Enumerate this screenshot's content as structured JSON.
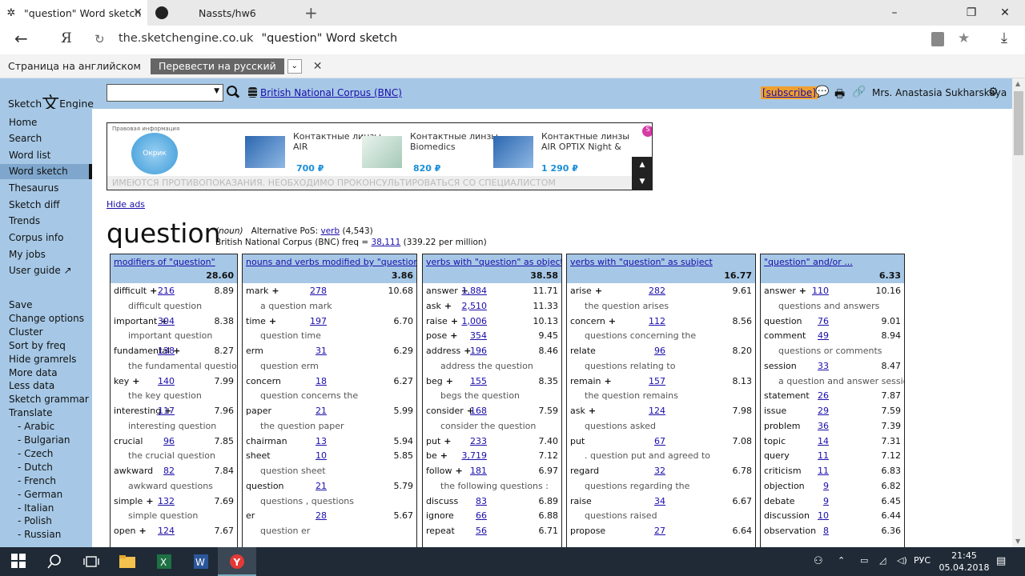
{
  "browser": {
    "tabs": [
      {
        "title": "\"question\" Word sketch",
        "close": "✕"
      },
      {
        "title": "Nassts/hw6"
      }
    ],
    "new_tab": "+",
    "window_controls": {
      "minimize": "–",
      "maximize": "❐",
      "close": "✕"
    },
    "back": "←",
    "yandex_logo": "Я",
    "reload": "↻",
    "url_domain": "the.sketchengine.co.uk",
    "url_title": "\"question\" Word sketch",
    "star": "★",
    "download": "⤓",
    "translate": {
      "label": "Страница на английском",
      "button": "Перевести на русский",
      "dropdown": "⌄",
      "close": "✕"
    }
  },
  "header": {
    "logo_left": "Sketch",
    "logo_mark": "文",
    "logo_right": "Engine",
    "search_value": "",
    "search_caret": "▼",
    "corpus": "British National Corpus (BNC)",
    "subscribe": "[subscribe]",
    "chat_icon": "💬",
    "print_icon": "🖶",
    "link_icon": "🔗",
    "user": "Mrs. Anastasia Sukharskaya",
    "gear_icon": "⚙"
  },
  "sidebar": {
    "nav": [
      "Home",
      "Search",
      "Word list",
      "Word sketch",
      "Thesaurus",
      "Sketch diff",
      "Trends",
      "Corpus info",
      "My jobs",
      "User guide ↗"
    ],
    "selected": "Word sketch",
    "actions": [
      "Save",
      "Change options",
      "Cluster",
      "Sort by freq",
      "Hide gramrels",
      "More data",
      "Less data",
      "Sketch grammar",
      "Translate"
    ],
    "languages": [
      "- Arabic",
      "- Bulgarian",
      "- Czech",
      "- Dutch",
      "- French",
      "- German",
      "- Italian",
      "- Polish",
      "- Russian"
    ]
  },
  "ad": {
    "legal": "Правовая информация",
    "logo_text": "Окрик",
    "products": [
      {
        "name": "Контактные линзы AIR",
        "price": "700 ₽"
      },
      {
        "name": "Контактные линзы Biomedics",
        "price": "820 ₽"
      },
      {
        "name": "Контактные линзы AIR OPTIX Night &",
        "price": "1 290 ₽"
      }
    ],
    "warning": "ИМЕЮТСЯ ПРОТИВОПОКАЗАНИЯ. НЕОБХОДИМО ПРОКОНСУЛЬТИРОВАТЬСЯ СО СПЕЦИАЛИСТОМ",
    "up": "▲",
    "down": "▼",
    "badge": "S"
  },
  "hide_ads": "Hide ads",
  "headword": {
    "word": "question",
    "pos": "(noun)",
    "alt_label": "Alternative PoS:",
    "alt_pos": "verb",
    "alt_count": "(4,543)",
    "freq_label": "British National Corpus (BNC) freq =",
    "freq": "38,111",
    "per_million": "(339.22 per million)"
  },
  "gramrels": [
    {
      "title": "modifiers of \"question\"",
      "score": "28.60",
      "rows": [
        {
          "word": "difficult",
          "plus": true,
          "freq": "216",
          "score": "8.89"
        },
        {
          "example": "difficult question"
        },
        {
          "word": "important",
          "plus": true,
          "freq": "304",
          "score": "8.38"
        },
        {
          "example": "important question"
        },
        {
          "word": "fundamental",
          "plus": true,
          "freq": "138",
          "score": "8.27"
        },
        {
          "example": "the fundamental question"
        },
        {
          "word": "key",
          "plus": true,
          "freq": "140",
          "score": "7.99"
        },
        {
          "example": "the key question"
        },
        {
          "word": "interesting",
          "plus": true,
          "freq": "117",
          "score": "7.96"
        },
        {
          "example": "interesting question"
        },
        {
          "word": "crucial",
          "plus": false,
          "freq": "96",
          "score": "7.85"
        },
        {
          "example": "the crucial question"
        },
        {
          "word": "awkward",
          "plus": false,
          "freq": "82",
          "score": "7.84"
        },
        {
          "example": "awkward questions"
        },
        {
          "word": "simple",
          "plus": true,
          "freq": "132",
          "score": "7.69"
        },
        {
          "example": "simple question"
        },
        {
          "word": "open",
          "plus": true,
          "freq": "124",
          "score": "7.67"
        }
      ]
    },
    {
      "title": "nouns and verbs modified by \"question\"",
      "score": "3.86",
      "rows": [
        {
          "word": "mark",
          "plus": true,
          "freq": "278",
          "score": "10.68"
        },
        {
          "example": "a question mark"
        },
        {
          "word": "time",
          "plus": true,
          "freq": "197",
          "score": "6.70"
        },
        {
          "example": "question time"
        },
        {
          "word": "erm",
          "plus": false,
          "freq": "31",
          "score": "6.29"
        },
        {
          "example": "question erm"
        },
        {
          "word": "concern",
          "plus": false,
          "freq": "18",
          "score": "6.27"
        },
        {
          "example": "question concerns the"
        },
        {
          "word": "paper",
          "plus": false,
          "freq": "21",
          "score": "5.99"
        },
        {
          "example": "the question paper"
        },
        {
          "word": "chairman",
          "plus": false,
          "freq": "13",
          "score": "5.94"
        },
        {
          "word": "sheet",
          "plus": false,
          "freq": "10",
          "score": "5.85"
        },
        {
          "example": "question sheet"
        },
        {
          "word": "question",
          "plus": false,
          "freq": "21",
          "score": "5.79"
        },
        {
          "example": "questions , questions"
        },
        {
          "word": "er",
          "plus": false,
          "freq": "28",
          "score": "5.67"
        },
        {
          "example": "question er"
        }
      ]
    },
    {
      "title": "verbs with \"question\" as object",
      "score": "38.58",
      "rows": [
        {
          "word": "answer",
          "plus": true,
          "freq": "1,884",
          "score": "11.71"
        },
        {
          "word": "ask",
          "plus": true,
          "freq": "2,510",
          "score": "11.33"
        },
        {
          "word": "raise",
          "plus": true,
          "freq": "1,006",
          "score": "10.13"
        },
        {
          "word": "pose",
          "plus": true,
          "freq": "354",
          "score": "9.45"
        },
        {
          "word": "address",
          "plus": true,
          "freq": "196",
          "score": "8.46"
        },
        {
          "example": "address the question"
        },
        {
          "word": "beg",
          "plus": true,
          "freq": "155",
          "score": "8.35"
        },
        {
          "example": "begs the question"
        },
        {
          "word": "consider",
          "plus": true,
          "freq": "168",
          "score": "7.59"
        },
        {
          "example": "consider the question"
        },
        {
          "word": "put",
          "plus": true,
          "freq": "233",
          "score": "7.40"
        },
        {
          "word": "be",
          "plus": true,
          "freq": "3,719",
          "score": "7.12"
        },
        {
          "word": "follow",
          "plus": true,
          "freq": "181",
          "score": "6.97"
        },
        {
          "example": "the following questions :"
        },
        {
          "word": "discuss",
          "plus": false,
          "freq": "83",
          "score": "6.89"
        },
        {
          "word": "ignore",
          "plus": false,
          "freq": "66",
          "score": "6.88"
        },
        {
          "word": "repeat",
          "plus": false,
          "freq": "56",
          "score": "6.71"
        }
      ]
    },
    {
      "title": "verbs with \"question\" as subject",
      "score": "16.77",
      "rows": [
        {
          "word": "arise",
          "plus": true,
          "freq": "282",
          "score": "9.61"
        },
        {
          "example": "the question arises"
        },
        {
          "word": "concern",
          "plus": true,
          "freq": "112",
          "score": "8.56"
        },
        {
          "example": "questions concerning the"
        },
        {
          "word": "relate",
          "plus": false,
          "freq": "96",
          "score": "8.20"
        },
        {
          "example": "questions relating to"
        },
        {
          "word": "remain",
          "plus": true,
          "freq": "157",
          "score": "8.13"
        },
        {
          "example": "the question remains"
        },
        {
          "word": "ask",
          "plus": true,
          "freq": "124",
          "score": "7.98"
        },
        {
          "example": "questions asked"
        },
        {
          "word": "put",
          "plus": false,
          "freq": "67",
          "score": "7.08"
        },
        {
          "example": ". question put and agreed to"
        },
        {
          "word": "regard",
          "plus": false,
          "freq": "32",
          "score": "6.78"
        },
        {
          "example": "questions regarding the"
        },
        {
          "word": "raise",
          "plus": false,
          "freq": "34",
          "score": "6.67"
        },
        {
          "example": "questions raised"
        },
        {
          "word": "propose",
          "plus": false,
          "freq": "27",
          "score": "6.64"
        }
      ]
    },
    {
      "title": "\"question\" and/or ...",
      "score": "6.33",
      "rows": [
        {
          "word": "answer",
          "plus": true,
          "freq": "110",
          "score": "10.16"
        },
        {
          "example": "questions and answers"
        },
        {
          "word": "question",
          "plus": false,
          "freq": "76",
          "score": "9.01"
        },
        {
          "word": "comment",
          "plus": false,
          "freq": "49",
          "score": "8.94"
        },
        {
          "example": "questions or comments"
        },
        {
          "word": "session",
          "plus": false,
          "freq": "33",
          "score": "8.47"
        },
        {
          "example": "a question and answer session"
        },
        {
          "word": "statement",
          "plus": false,
          "freq": "26",
          "score": "7.87"
        },
        {
          "word": "issue",
          "plus": false,
          "freq": "29",
          "score": "7.59"
        },
        {
          "word": "problem",
          "plus": false,
          "freq": "36",
          "score": "7.39"
        },
        {
          "word": "topic",
          "plus": false,
          "freq": "14",
          "score": "7.31"
        },
        {
          "word": "query",
          "plus": false,
          "freq": "11",
          "score": "7.12"
        },
        {
          "word": "criticism",
          "plus": false,
          "freq": "11",
          "score": "6.83"
        },
        {
          "word": "objection",
          "plus": false,
          "freq": "9",
          "score": "6.82"
        },
        {
          "word": "debate",
          "plus": false,
          "freq": "9",
          "score": "6.45"
        },
        {
          "word": "discussion",
          "plus": false,
          "freq": "10",
          "score": "6.44"
        },
        {
          "word": "observation",
          "plus": false,
          "freq": "8",
          "score": "6.36"
        }
      ]
    }
  ],
  "taskbar": {
    "tray_lang": "РУС",
    "time": "21:45",
    "date": "05.04.2018"
  }
}
